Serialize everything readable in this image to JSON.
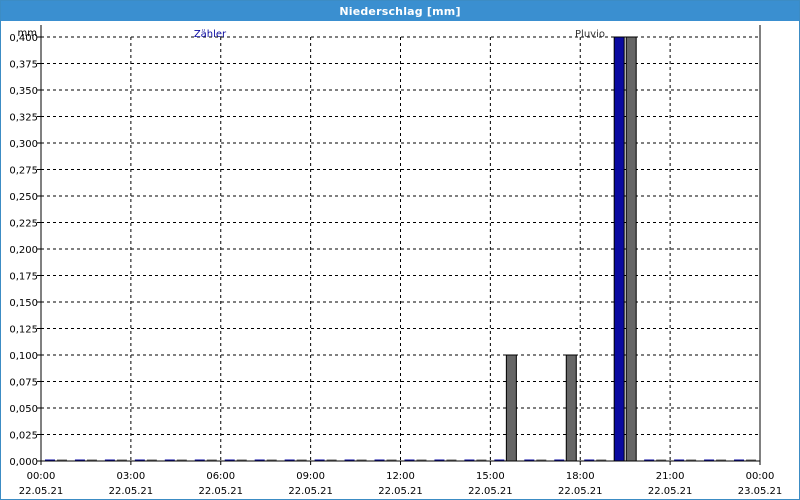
{
  "window": {
    "title": "Niederschlag [mm]"
  },
  "colors": {
    "titlebar": "#3a8fd0",
    "series_1": "#0a0aa0",
    "series_2": "#666666",
    "grid": "#000000"
  },
  "chart_data": {
    "type": "bar",
    "title": "Niederschlag [mm]",
    "ylabel": "mm",
    "xlabel": "",
    "ylim": [
      0,
      0.4
    ],
    "grid": true,
    "legend_placement": "top",
    "yticks": [
      "0,000",
      "0,025",
      "0,050",
      "0,075",
      "0,100",
      "0,125",
      "0,150",
      "0,175",
      "0,200",
      "0,225",
      "0,250",
      "0,275",
      "0,300",
      "0,325",
      "0,350",
      "0,375",
      "0,400"
    ],
    "xticks": [
      {
        "time": "00:00",
        "date": "22.05.21"
      },
      {
        "time": "03:00",
        "date": "22.05.21"
      },
      {
        "time": "06:00",
        "date": "22.05.21"
      },
      {
        "time": "09:00",
        "date": "22.05.21"
      },
      {
        "time": "12:00",
        "date": "22.05.21"
      },
      {
        "time": "15:00",
        "date": "22.05.21"
      },
      {
        "time": "18:00",
        "date": "22.05.21"
      },
      {
        "time": "21:00",
        "date": "22.05.21"
      },
      {
        "time": "00:00",
        "date": "23.05.21"
      }
    ],
    "x_range_hours": [
      0,
      24
    ],
    "bar_interval_hours": 1,
    "series": [
      {
        "name": "Zähler",
        "color": "#0a0aa0",
        "values": [
          0,
          0,
          0,
          0,
          0,
          0,
          0,
          0,
          0,
          0,
          0,
          0,
          0,
          0,
          0,
          0,
          0,
          0,
          0,
          0.4,
          0,
          0,
          0,
          0
        ]
      },
      {
        "name": "Pluvio",
        "color": "#666666",
        "values": [
          0,
          0,
          0,
          0,
          0,
          0,
          0,
          0,
          0,
          0,
          0,
          0,
          0,
          0,
          0,
          0.1,
          0,
          0.1,
          0,
          0.4,
          0,
          0,
          0,
          0
        ]
      }
    ]
  }
}
